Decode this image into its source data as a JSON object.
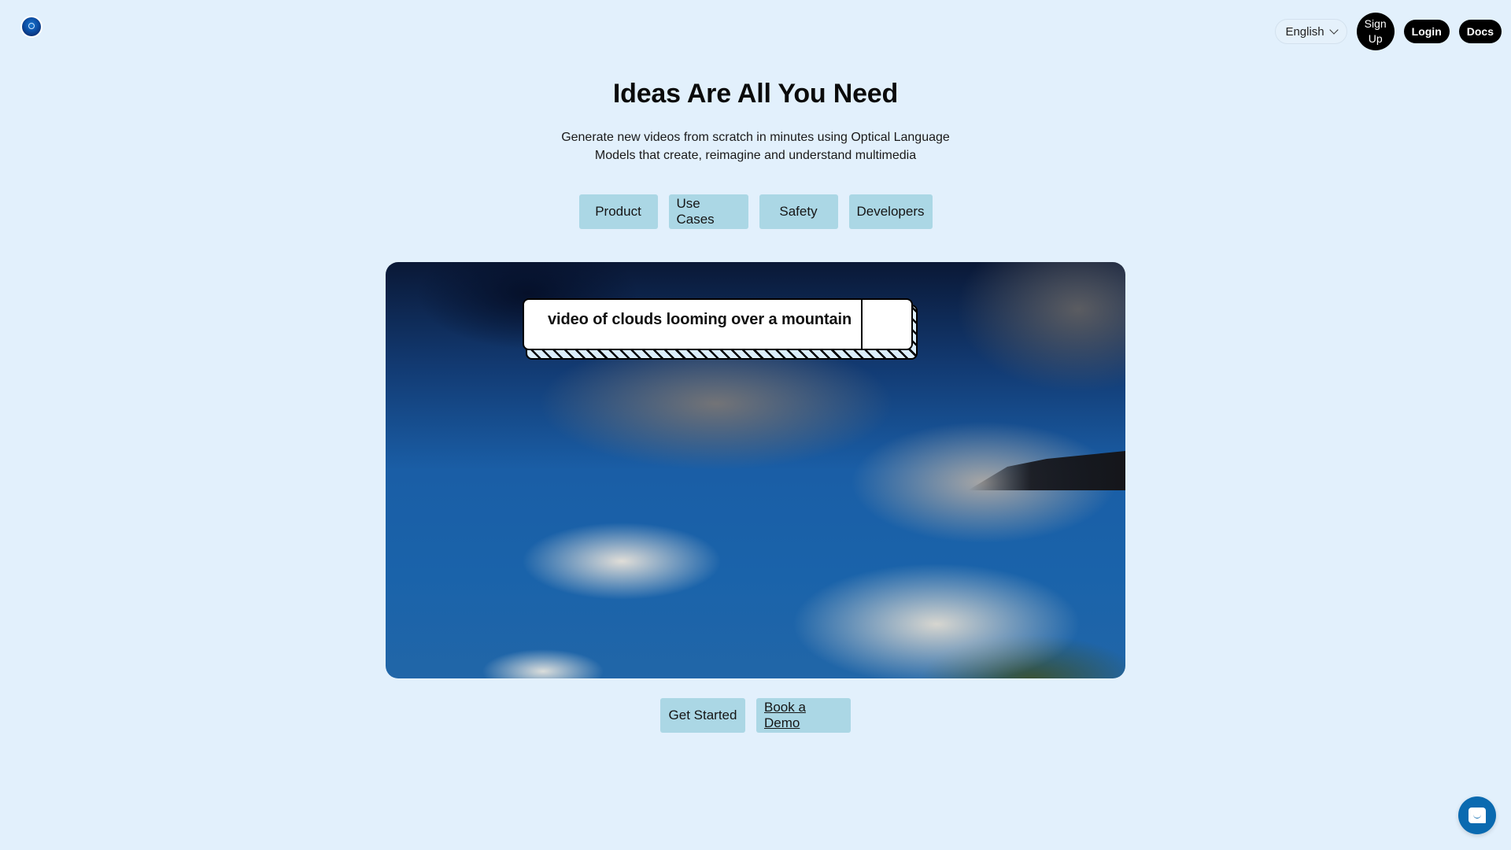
{
  "header": {
    "logo_icon": "camera-lens-logo-icon",
    "language": {
      "selected": "English",
      "icon": "chevron-down-icon"
    },
    "buttons": {
      "sign_up": "Sign Up",
      "login": "Login",
      "docs": "Docs"
    }
  },
  "hero": {
    "title": "Ideas Are All You Need",
    "subtitle": "Generate new videos from scratch in minutes using Optical Language Models that create, reimagine and understand multimedia"
  },
  "tabs": [
    {
      "label": "Product"
    },
    {
      "label": "Use Cases"
    },
    {
      "label": "Safety"
    },
    {
      "label": "Developers"
    }
  ],
  "video": {
    "prompt": "video of clouds looming over a mountain"
  },
  "ctas": {
    "get_started": "Get Started",
    "book_demo": "Book a Demo"
  },
  "chat_widget": {
    "icon": "chat-bubble-icon"
  },
  "colors": {
    "background": "#e2f0fc",
    "button_bg": "#abd7e5",
    "dark_button": "#000000",
    "chat_widget": "#0a6ab0"
  }
}
